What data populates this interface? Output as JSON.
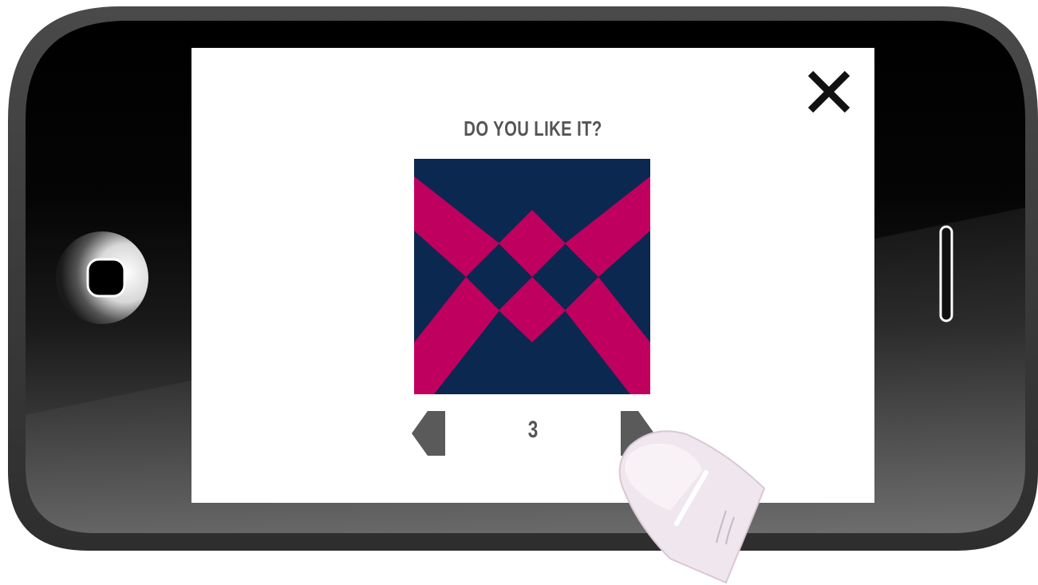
{
  "dialog": {
    "title": "DO YOU LIKE IT?",
    "page_number": "3"
  },
  "icons": {
    "close": "close-icon",
    "prev": "prev-arrow-icon",
    "next": "next-arrow-icon",
    "home": "home-button-icon"
  },
  "colors": {
    "pattern_primary": "#0b2850",
    "pattern_accent": "#c0005e",
    "text": "#555555",
    "close_icon": "#111111",
    "arrow": "#5a5a5a",
    "phone_body": "#3a3a3a",
    "phone_bezel": "#0a0a0a"
  }
}
